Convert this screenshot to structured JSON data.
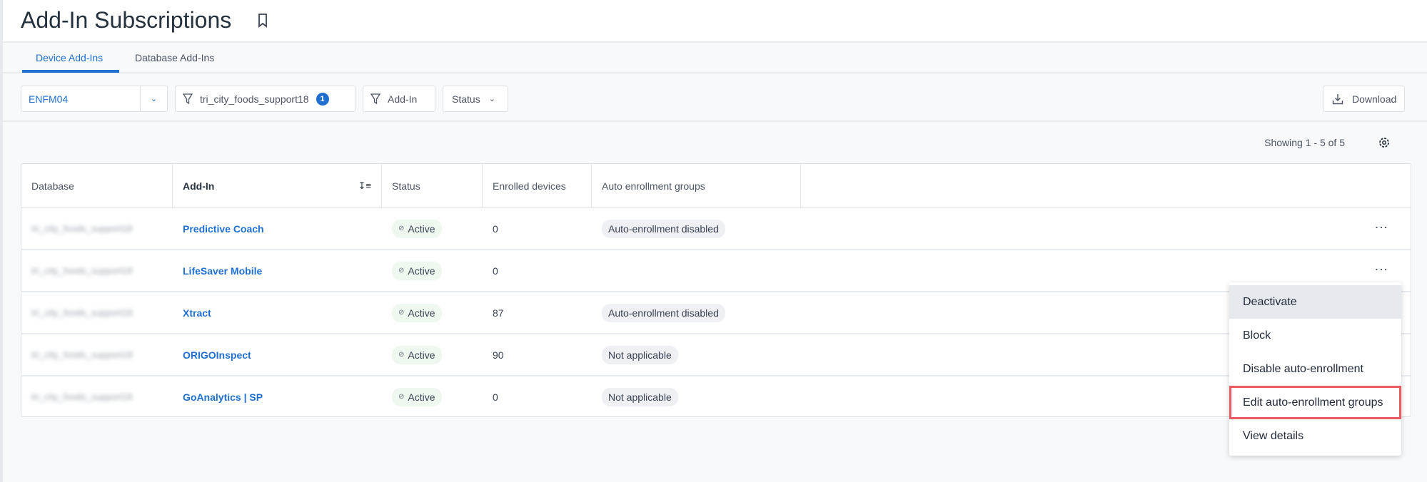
{
  "page": {
    "title": "Add-In Subscriptions"
  },
  "tabs": [
    {
      "label": "Device Add-Ins",
      "active": true
    },
    {
      "label": "Database Add-Ins",
      "active": false
    }
  ],
  "filters": {
    "database": "ENFM04",
    "db_filter": "tri_city_foods_support18",
    "db_filter_count": "1",
    "addin_filter": "Add-In",
    "status_filter": "Status",
    "download": "Download"
  },
  "showing": "Showing 1 - 5 of 5",
  "table": {
    "columns": [
      "Database",
      "Add-In",
      "Status",
      "Enrolled devices",
      "Auto enrollment groups"
    ],
    "rows": [
      {
        "database": "tri_city_foods_support18",
        "addin": "Predictive Coach",
        "status": "Active",
        "enrolled": "0",
        "auto": "Auto-enrollment disabled"
      },
      {
        "database": "tri_city_foods_support18",
        "addin": "LifeSaver Mobile",
        "status": "Active",
        "enrolled": "0",
        "auto": ""
      },
      {
        "database": "tri_city_foods_support18",
        "addin": "Xtract",
        "status": "Active",
        "enrolled": "87",
        "auto": "Auto-enrollment disabled"
      },
      {
        "database": "tri_city_foods_support18",
        "addin": "ORIGOInspect",
        "status": "Active",
        "enrolled": "90",
        "auto": "Not applicable"
      },
      {
        "database": "tri_city_foods_support18",
        "addin": "GoAnalytics | SP",
        "status": "Active",
        "enrolled": "0",
        "auto": "Not applicable"
      }
    ]
  },
  "menu": {
    "items": [
      "Deactivate",
      "Block",
      "Disable auto-enrollment",
      "Edit auto-enrollment groups",
      "View details"
    ]
  },
  "colors": {
    "accent": "#1f6fd0",
    "highlight": "#ea5a62"
  }
}
